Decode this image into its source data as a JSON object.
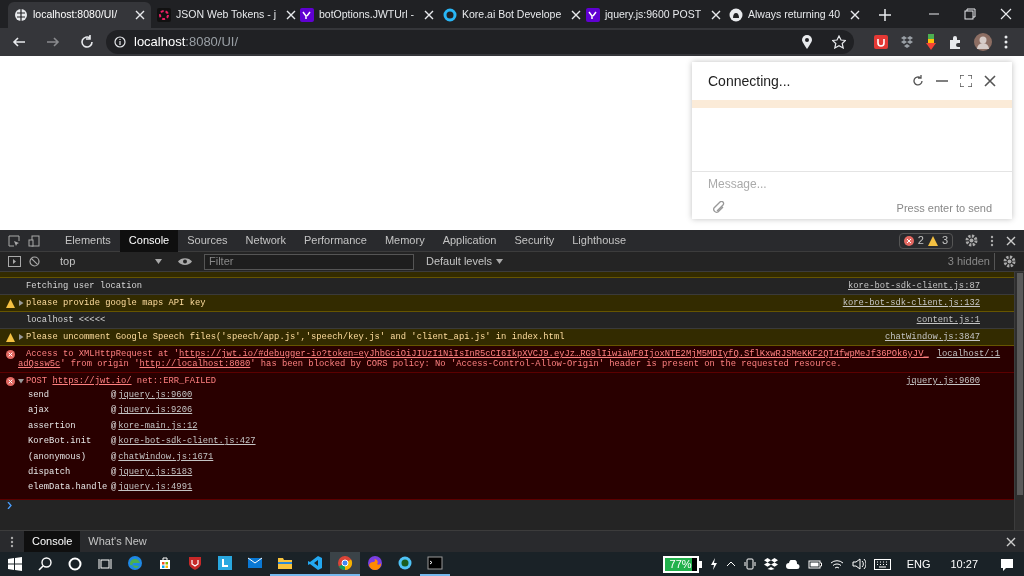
{
  "browser": {
    "tabs": [
      {
        "title": "localhost:8080/UI/",
        "selected": true,
        "kind": "globe"
      },
      {
        "title": "JSON Web Tokens - j",
        "selected": false,
        "kind": "star"
      },
      {
        "title": "botOptions.JWTUrl -",
        "selected": false,
        "kind": "yahoo"
      },
      {
        "title": "Kore.ai Bot Develope",
        "selected": false,
        "kind": "ring"
      },
      {
        "title": "jquery.js:9600 POST",
        "selected": false,
        "kind": "yahoo"
      },
      {
        "title": "Always returning 40",
        "selected": false,
        "kind": "cat"
      }
    ],
    "address": {
      "host": "localhost",
      "path": ":8080/UI/"
    }
  },
  "chat": {
    "title": "Connecting...",
    "placeholder": "Message...",
    "hint": "Press enter to send"
  },
  "devtools": {
    "panels": [
      {
        "label": "Elements",
        "selected": false
      },
      {
        "label": "Console",
        "selected": true
      },
      {
        "label": "Sources",
        "selected": false
      },
      {
        "label": "Network",
        "selected": false
      },
      {
        "label": "Performance",
        "selected": false
      },
      {
        "label": "Memory",
        "selected": false
      },
      {
        "label": "Application",
        "selected": false
      },
      {
        "label": "Security",
        "selected": false
      },
      {
        "label": "Lighthouse",
        "selected": false
      }
    ],
    "error_count": "2",
    "warning_count": "3",
    "context": "top",
    "filter_placeholder": "Filter",
    "levels": "Default levels",
    "hidden": "3 hidden"
  },
  "messages": [
    {
      "kind": "log",
      "lines": [
        [
          {
            "text": "Fetching user location",
            "kind": "text"
          }
        ]
      ],
      "source": "kore-bot-sdk-client.js:87"
    },
    {
      "kind": "warning",
      "expanded": false,
      "lines": [
        [
          {
            "text": "please provide google maps API key",
            "kind": "text"
          }
        ]
      ],
      "source": "kore-bot-sdk-client.js:132"
    },
    {
      "kind": "log",
      "lines": [
        [
          {
            "text": "localhost <<<<<",
            "kind": "text"
          }
        ]
      ],
      "source": "content.js:1"
    },
    {
      "kind": "warning",
      "expanded": false,
      "lines": [
        [
          {
            "text": "Please uncomment Google Speech files('speech/app.js','speech/key.js' and 'client_api.js' in index.html",
            "kind": "text"
          }
        ]
      ],
      "source": "chatWindow.js:3847"
    },
    {
      "kind": "error",
      "lines": [
        [
          {
            "text": "Access to XMLHttpRequest at '",
            "kind": "text"
          },
          {
            "text": "https://jwt.io/#debugger-io?token=eyJhbGciOiJIUzI1NiIsInR5cCI6IkpXVCJ9.eyJz…RG9lIiwiaWF0IjoxNTE2MjM5MDIyfQ.SflKxwRJSMeKKF2QT4fwpMeJf36POk6yJV_",
            "kind": "link"
          }
        ],
        [
          {
            "text": "adQssw5c",
            "kind": "link"
          },
          {
            "text": "' from origin '",
            "kind": "text"
          },
          {
            "text": "http://localhost:8080",
            "kind": "link"
          },
          {
            "text": "' has been blocked by CORS policy: No 'Access-Control-Allow-Origin' header is present on the requested resource.",
            "kind": "text"
          }
        ]
      ],
      "source": "localhost/:1"
    },
    {
      "kind": "error",
      "expanded": true,
      "lines": [
        [
          {
            "text": "POST ",
            "kind": "text"
          },
          {
            "text": "https://jwt.io/",
            "kind": "link"
          },
          {
            "text": " net::ERR_FAILED",
            "kind": "text"
          }
        ]
      ],
      "source": "jquery.js:9600",
      "frames": [
        {
          "fn": "send",
          "at": "@",
          "link": "jquery.js:9600"
        },
        {
          "fn": "ajax",
          "at": "@",
          "link": "jquery.js:9206"
        },
        {
          "fn": "assertion",
          "at": "@",
          "link": "kore-main.js:12"
        },
        {
          "fn": "KoreBot.init",
          "at": "@",
          "link": "kore-bot-sdk-client.js:427"
        },
        {
          "fn": "(anonymous)",
          "at": "@",
          "link": "chatWindow.js:1671"
        },
        {
          "fn": "dispatch",
          "at": "@",
          "link": "jquery.js:5183"
        },
        {
          "fn": "elemData.handle",
          "at": "@",
          "link": "jquery.js:4991"
        }
      ]
    }
  ],
  "drawer": {
    "tabs": [
      {
        "label": "Console",
        "selected": true
      },
      {
        "label": "What's New",
        "selected": false
      }
    ]
  },
  "taskbar": {
    "apps": [
      {
        "kind": "edge",
        "active": false
      },
      {
        "kind": "store",
        "active": false
      },
      {
        "kind": "shield",
        "active": false
      },
      {
        "kind": "blue",
        "active": false
      },
      {
        "kind": "mail",
        "active": false
      },
      {
        "kind": "folder",
        "active": true
      },
      {
        "kind": "code",
        "active": true
      },
      {
        "kind": "chrome",
        "active": true
      },
      {
        "kind": "fox",
        "active": false
      },
      {
        "kind": "ring",
        "active": false
      },
      {
        "kind": "terminal",
        "active": true
      }
    ],
    "battery": "77%",
    "language": "ENG",
    "time": "10:27"
  }
}
